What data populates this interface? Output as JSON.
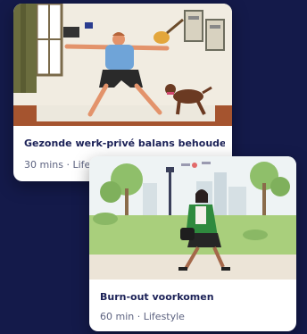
{
  "cards": [
    {
      "title": "Gezonde werk-privé balans behouden",
      "duration": "30 mins",
      "separator": "·",
      "category": "Lifestyle",
      "illustration": "yoga-with-dog-illustration"
    },
    {
      "title": "Burn-out voorkomen",
      "duration": "60 min",
      "separator": "·",
      "category": "Lifestyle",
      "illustration": "woman-walking-in-park-illustration"
    }
  ],
  "colors": {
    "background": "#141a4a",
    "card": "#ffffff",
    "title": "#1b2157",
    "meta": "#5d6380"
  }
}
